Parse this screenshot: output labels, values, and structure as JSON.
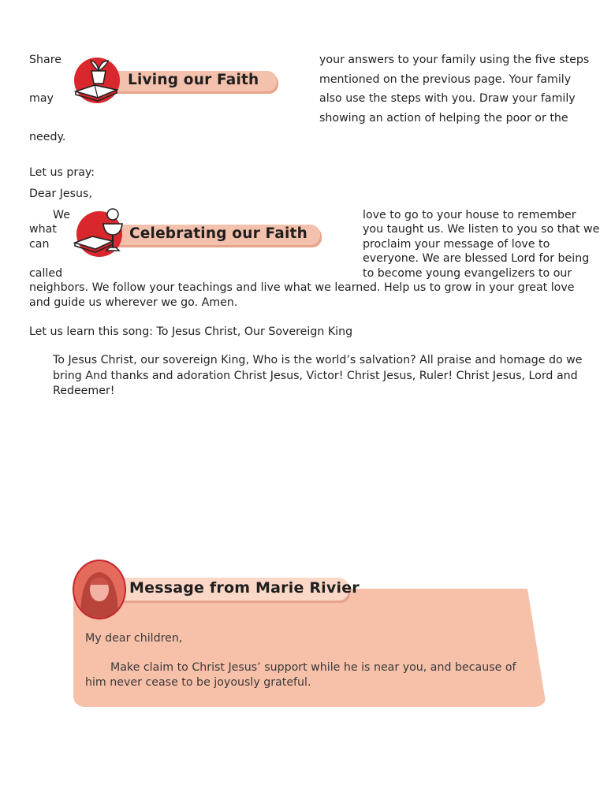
{
  "living": {
    "heading": "Living our Faith",
    "words": {
      "share": "Share",
      "may": "may",
      "needy": "needy."
    },
    "lines": [
      "your answers to your family using the five steps",
      "mentioned on the previous page. Your family",
      "also use the steps with you. Draw your family",
      "showing an action of helping the poor or the"
    ]
  },
  "prayer": {
    "intro": "Let us pray:",
    "salutation": "Dear Jesus,",
    "words": {
      "we": "We",
      "what": "what",
      "can": "can",
      "called": "called"
    },
    "right_lines": [
      "love to go to your house to remember",
      "you taught us. We listen to you so that we",
      "proclaim your message of love to",
      "everyone. We are blessed Lord for being",
      "to become young evangelizers to our"
    ],
    "tail_lines": [
      "neighbors. We follow your teachings and live what we learned. Help us to grow in your great love",
      "and guide us wherever we go. Amen."
    ]
  },
  "celebrating": {
    "heading": "Celebrating our Faith"
  },
  "song": {
    "intro": "Let us learn this song: To Jesus Christ, Our Sovereign King",
    "lyrics": "To Jesus Christ, our sovereign King, Who is the world’s salvation? All praise and homage do we bring And thanks and adoration Christ Jesus, Victor! Christ Jesus, Ruler! Christ Jesus, Lord and Redeemer!"
  },
  "message": {
    "heading": "Message from Marie Rivier",
    "greeting": "My dear children,",
    "body": "Make claim to Christ Jesus’ support while he is near you, and because of him never cease to be joyously grateful."
  },
  "colors": {
    "accent_red": "#d8272d",
    "ribbon": "#f4c1ad",
    "message_box": "#f7c0a9"
  },
  "icons": [
    "plant-book-icon",
    "chalice-book-icon",
    "marie-rivier-portrait"
  ]
}
